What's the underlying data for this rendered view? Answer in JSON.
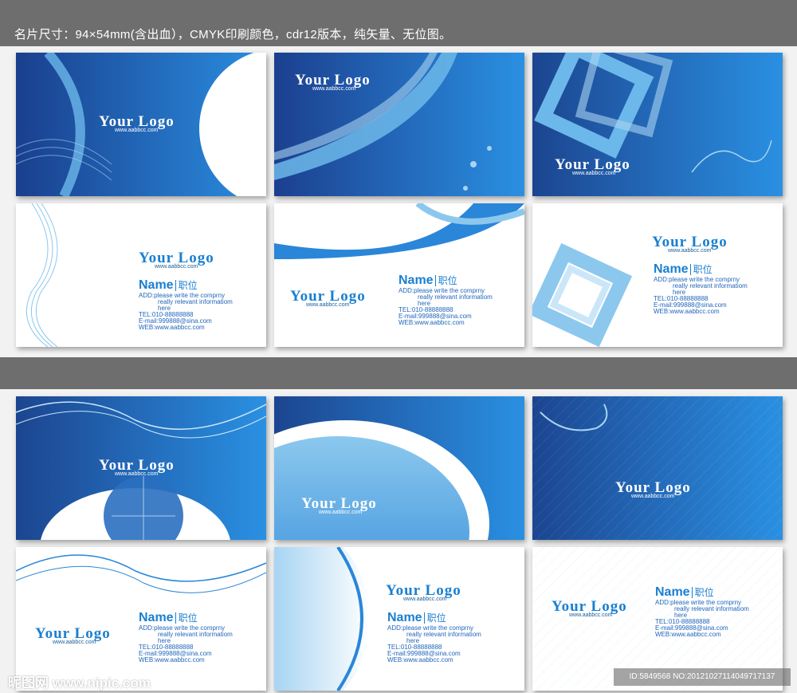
{
  "header": {
    "title": "名片尺寸：94×54mm(含出血），CMYK印刷颜色，cdr12版本，纯矢量、无位图。"
  },
  "logo_text": "Your Logo",
  "url_text": "www.aabbcc.com",
  "contact": {
    "name": "Name",
    "position": "职位",
    "add_line1": "ADD:please write the comprny",
    "add_line2": "really relevant informatiom",
    "add_line3": "here",
    "tel": "TEL:010-88888888",
    "email": "E-mail:999888@sina.com",
    "web": "WEB:www.aabbcc.com"
  },
  "watermark": {
    "site": "昵图网 www.nipic.com",
    "id": "ID:5849568 NO:20121027114049717137"
  },
  "colors": {
    "brand_blue": "#1a7fd0",
    "dark_blue": "#1c4a9a",
    "light_blue": "#6cb8ea"
  }
}
